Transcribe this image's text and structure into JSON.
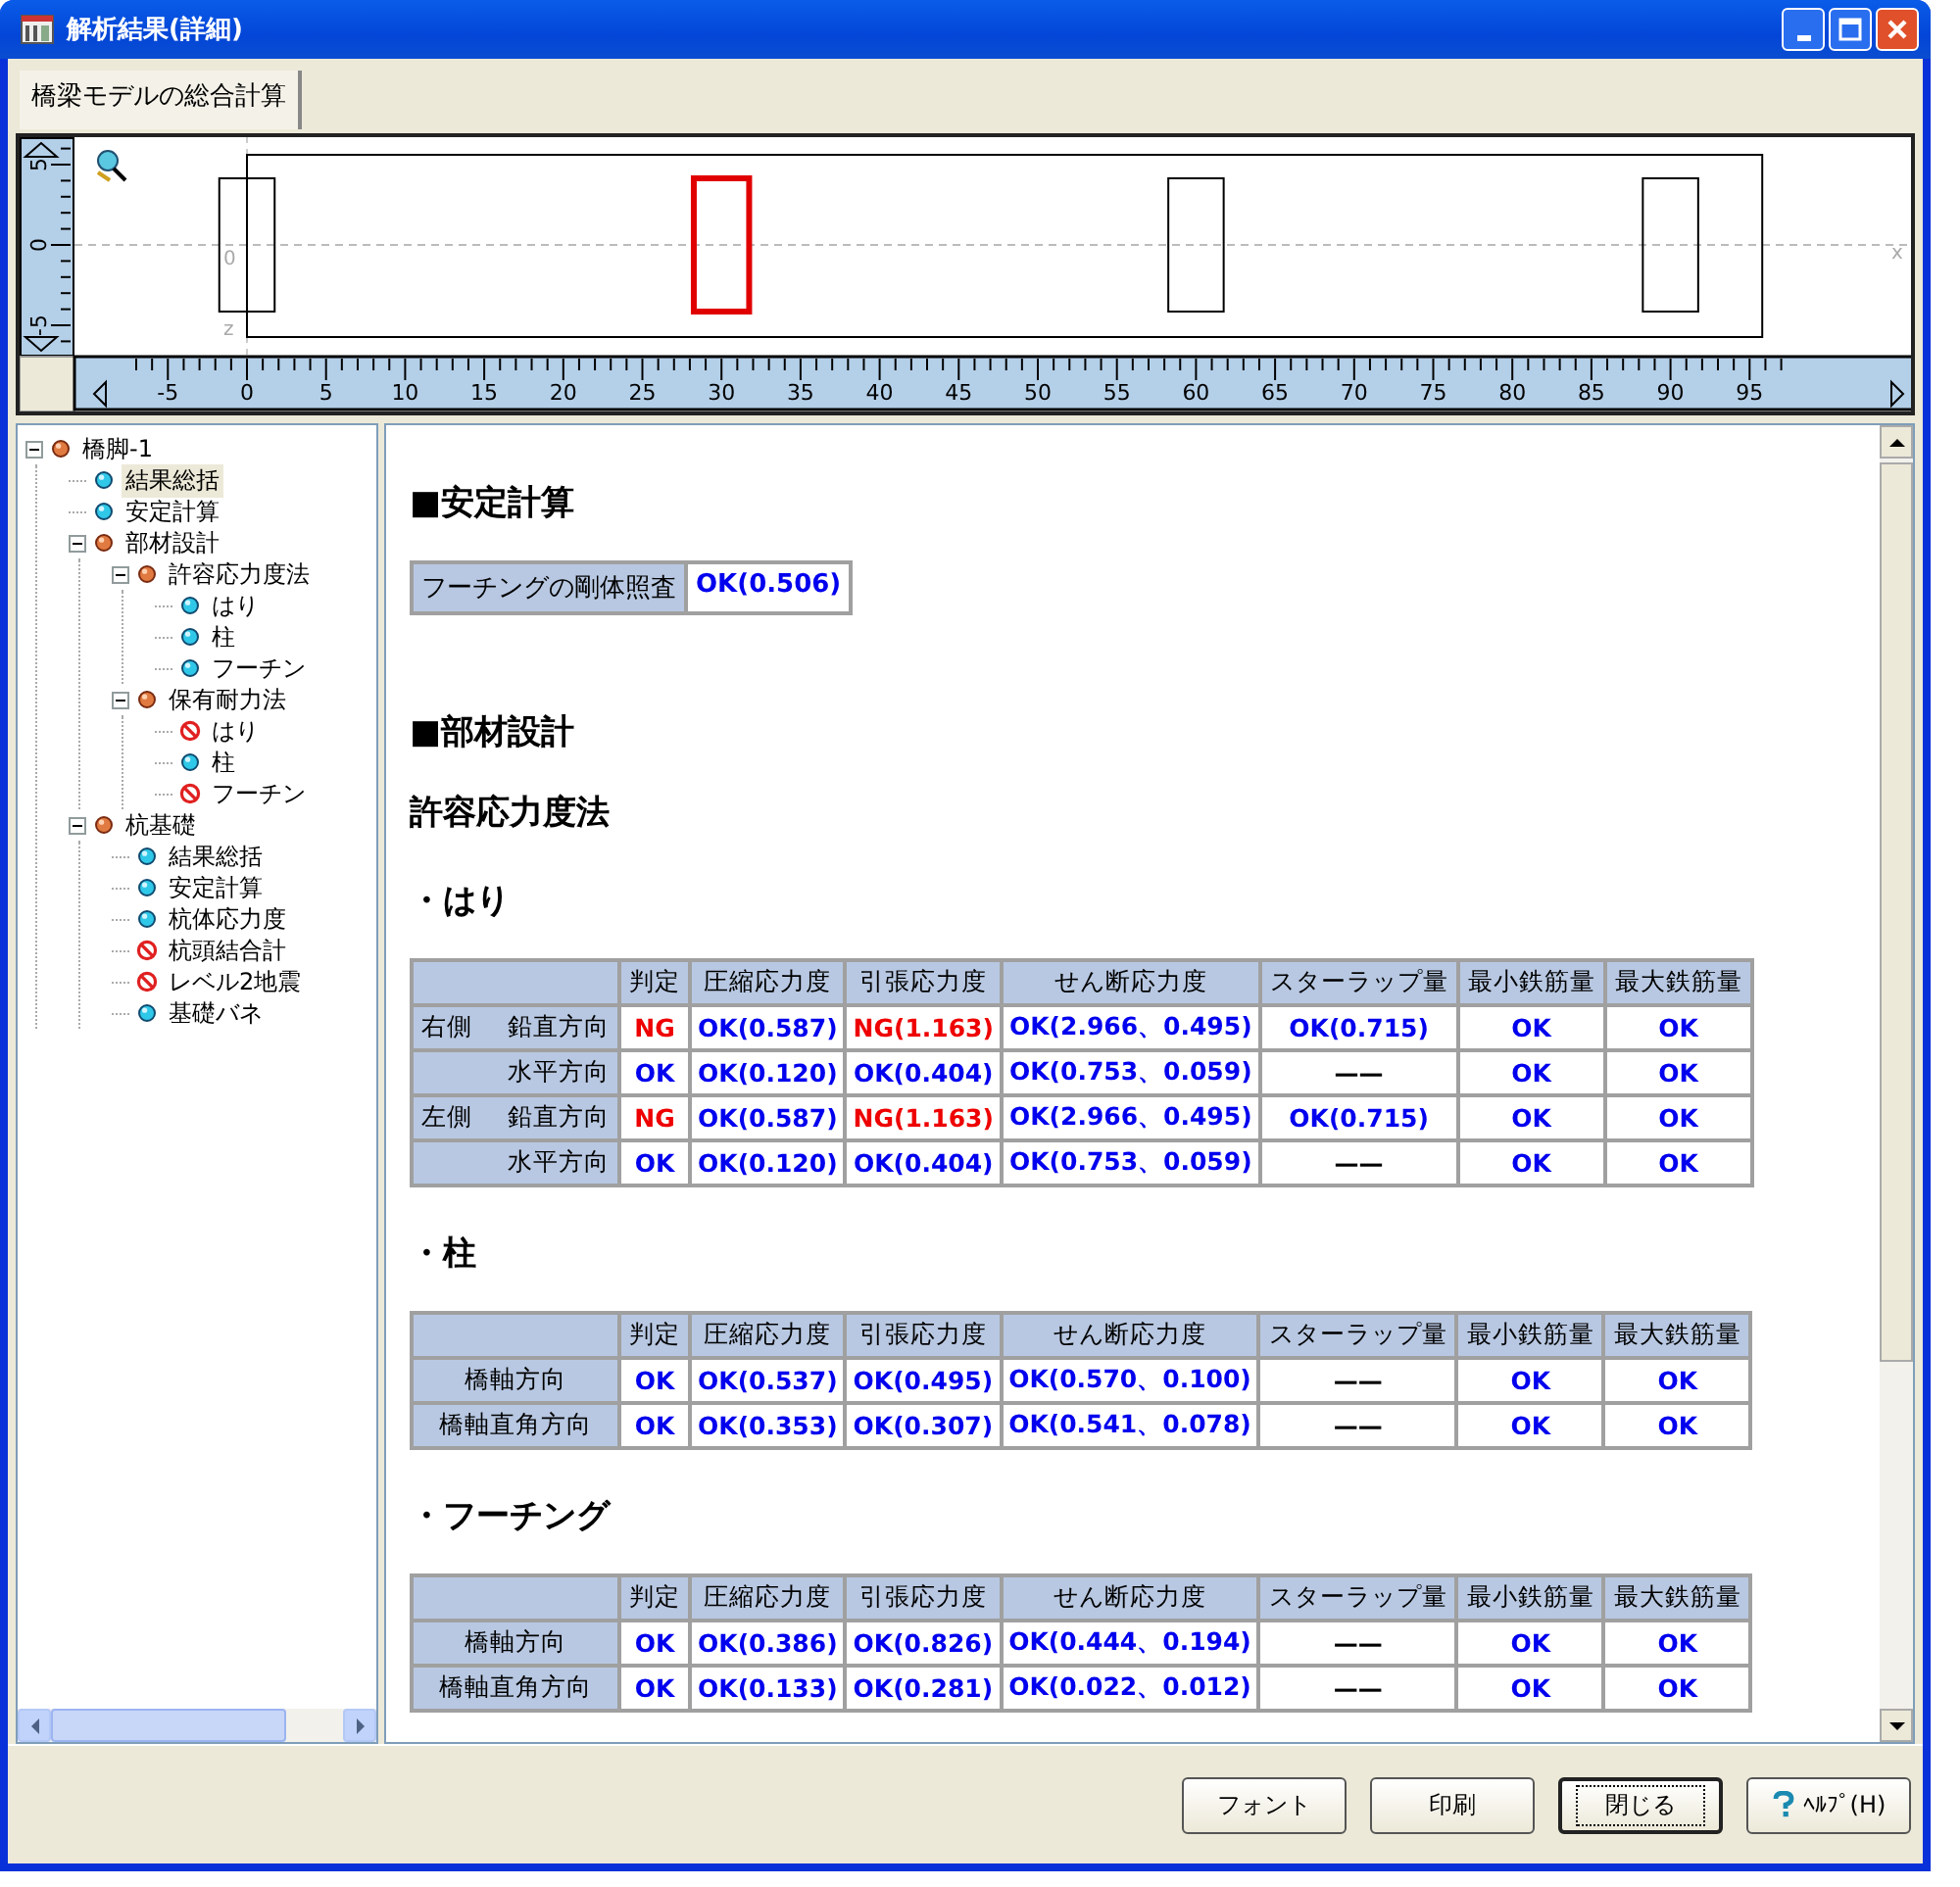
{
  "window": {
    "title": "解析結果(詳細)"
  },
  "tabs": [
    {
      "label": "橋梁モデルの総合計算",
      "selected": true
    }
  ],
  "diagram": {
    "origin_label": "0",
    "z_label": "z",
    "x_label": "x",
    "x_ruler_labels": [
      "-5",
      "0",
      "5",
      "10",
      "15",
      "20",
      "25",
      "30",
      "35",
      "40",
      "45",
      "50",
      "55",
      "60",
      "65",
      "70",
      "75",
      "80",
      "85",
      "90",
      "95"
    ],
    "y_ruler_labels": [
      "5",
      "0",
      "-5"
    ],
    "piers": [
      {
        "selected": false
      },
      {
        "selected": true
      },
      {
        "selected": false
      },
      {
        "selected": false
      }
    ]
  },
  "tree": [
    {
      "label": "橋脚-1",
      "kind": "group",
      "expanded": true,
      "selected": false,
      "children": [
        {
          "label": "結果総括",
          "kind": "ok",
          "selected": true
        },
        {
          "label": "安定計算",
          "kind": "ok",
          "selected": false
        },
        {
          "label": "部材設計",
          "kind": "group",
          "expanded": true,
          "selected": false,
          "children": [
            {
              "label": "許容応力度法",
              "kind": "group",
              "expanded": true,
              "selected": false,
              "children": [
                {
                  "label": "はり",
                  "kind": "ok",
                  "selected": false
                },
                {
                  "label": "柱",
                  "kind": "ok",
                  "selected": false
                },
                {
                  "label": "フーチン",
                  "kind": "ok",
                  "selected": false
                }
              ]
            },
            {
              "label": "保有耐力法",
              "kind": "group",
              "expanded": true,
              "selected": false,
              "children": [
                {
                  "label": "はり",
                  "kind": "ng",
                  "selected": false
                },
                {
                  "label": "柱",
                  "kind": "ok",
                  "selected": false
                },
                {
                  "label": "フーチン",
                  "kind": "ng",
                  "selected": false
                }
              ]
            }
          ]
        },
        {
          "label": "杭基礎",
          "kind": "group",
          "expanded": true,
          "selected": false,
          "children": [
            {
              "label": "結果総括",
              "kind": "ok",
              "selected": false
            },
            {
              "label": "安定計算",
              "kind": "ok",
              "selected": false
            },
            {
              "label": "杭体応力度",
              "kind": "ok",
              "selected": false
            },
            {
              "label": "杭頭結合計",
              "kind": "ng",
              "selected": false
            },
            {
              "label": "レベル2地震",
              "kind": "ng",
              "selected": false
            },
            {
              "label": "基礎バネ",
              "kind": "ok",
              "selected": false
            }
          ]
        }
      ]
    }
  ],
  "content": [
    {
      "kind": "heading",
      "text": "■安定計算"
    },
    {
      "kind": "check",
      "label": "フーチングの剛体照査",
      "value": "OK(0.506)",
      "ng": false
    },
    {
      "kind": "heading",
      "text": "■部材設計"
    },
    {
      "kind": "subheading",
      "text": "許容応力度法"
    },
    {
      "kind": "section",
      "text": "・はり"
    },
    {
      "kind": "table",
      "columns": [
        "判定",
        "圧縮応力度",
        "引張応力度",
        "せん断応力度",
        "スターラップ量",
        "最小鉄筋量",
        "最大鉄筋量"
      ],
      "rows": [
        {
          "group": "右側",
          "label": "鉛直方向",
          "cells": [
            {
              "text": "NG",
              "kind": "ng"
            },
            {
              "text": "OK(0.587)",
              "kind": "ok"
            },
            {
              "text": "NG(1.163)",
              "kind": "ng"
            },
            {
              "text": "OK(2.966、0.495)",
              "kind": "ok"
            },
            {
              "text": "OK(0.715)",
              "kind": "ok"
            },
            {
              "text": "OK",
              "kind": "ok"
            },
            {
              "text": "OK",
              "kind": "ok"
            }
          ]
        },
        {
          "label": "水平方向",
          "cells": [
            {
              "text": "OK",
              "kind": "ok"
            },
            {
              "text": "OK(0.120)",
              "kind": "ok"
            },
            {
              "text": "OK(0.404)",
              "kind": "ok"
            },
            {
              "text": "OK(0.753、0.059)",
              "kind": "ok"
            },
            {
              "text": "——",
              "kind": "dash"
            },
            {
              "text": "OK",
              "kind": "ok"
            },
            {
              "text": "OK",
              "kind": "ok"
            }
          ]
        },
        {
          "group": "左側",
          "label": "鉛直方向",
          "cells": [
            {
              "text": "NG",
              "kind": "ng"
            },
            {
              "text": "OK(0.587)",
              "kind": "ok"
            },
            {
              "text": "NG(1.163)",
              "kind": "ng"
            },
            {
              "text": "OK(2.966、0.495)",
              "kind": "ok"
            },
            {
              "text": "OK(0.715)",
              "kind": "ok"
            },
            {
              "text": "OK",
              "kind": "ok"
            },
            {
              "text": "OK",
              "kind": "ok"
            }
          ]
        },
        {
          "label": "水平方向",
          "cells": [
            {
              "text": "OK",
              "kind": "ok"
            },
            {
              "text": "OK(0.120)",
              "kind": "ok"
            },
            {
              "text": "OK(0.404)",
              "kind": "ok"
            },
            {
              "text": "OK(0.753、0.059)",
              "kind": "ok"
            },
            {
              "text": "——",
              "kind": "dash"
            },
            {
              "text": "OK",
              "kind": "ok"
            },
            {
              "text": "OK",
              "kind": "ok"
            }
          ]
        }
      ]
    },
    {
      "kind": "section",
      "text": "・柱"
    },
    {
      "kind": "table",
      "columns": [
        "判定",
        "圧縮応力度",
        "引張応力度",
        "せん断応力度",
        "スターラップ量",
        "最小鉄筋量",
        "最大鉄筋量"
      ],
      "rows": [
        {
          "label": "橋軸方向",
          "cells": [
            {
              "text": "OK",
              "kind": "ok"
            },
            {
              "text": "OK(0.537)",
              "kind": "ok"
            },
            {
              "text": "OK(0.495)",
              "kind": "ok"
            },
            {
              "text": "OK(0.570、0.100)",
              "kind": "ok"
            },
            {
              "text": "——",
              "kind": "dash"
            },
            {
              "text": "OK",
              "kind": "ok"
            },
            {
              "text": "OK",
              "kind": "ok"
            }
          ]
        },
        {
          "label": "橋軸直角方向",
          "cells": [
            {
              "text": "OK",
              "kind": "ok"
            },
            {
              "text": "OK(0.353)",
              "kind": "ok"
            },
            {
              "text": "OK(0.307)",
              "kind": "ok"
            },
            {
              "text": "OK(0.541、0.078)",
              "kind": "ok"
            },
            {
              "text": "——",
              "kind": "dash"
            },
            {
              "text": "OK",
              "kind": "ok"
            },
            {
              "text": "OK",
              "kind": "ok"
            }
          ]
        }
      ]
    },
    {
      "kind": "section",
      "text": "・フーチング"
    },
    {
      "kind": "table",
      "columns": [
        "判定",
        "圧縮応力度",
        "引張応力度",
        "せん断応力度",
        "スターラップ量",
        "最小鉄筋量",
        "最大鉄筋量"
      ],
      "rows": [
        {
          "label": "橋軸方向",
          "cells": [
            {
              "text": "OK",
              "kind": "ok"
            },
            {
              "text": "OK(0.386)",
              "kind": "ok"
            },
            {
              "text": "OK(0.826)",
              "kind": "ok"
            },
            {
              "text": "OK(0.444、0.194)",
              "kind": "ok"
            },
            {
              "text": "——",
              "kind": "dash"
            },
            {
              "text": "OK",
              "kind": "ok"
            },
            {
              "text": "OK",
              "kind": "ok"
            }
          ]
        },
        {
          "label": "橋軸直角方向",
          "cells": [
            {
              "text": "OK",
              "kind": "ok"
            },
            {
              "text": "OK(0.133)",
              "kind": "ok"
            },
            {
              "text": "OK(0.281)",
              "kind": "ok"
            },
            {
              "text": "OK(0.022、0.012)",
              "kind": "ok"
            },
            {
              "text": "——",
              "kind": "dash"
            },
            {
              "text": "OK",
              "kind": "ok"
            },
            {
              "text": "OK",
              "kind": "ok"
            }
          ]
        }
      ]
    }
  ],
  "buttons": [
    {
      "label": "フォント",
      "focused": false,
      "kind": "plain"
    },
    {
      "label": "印刷",
      "focused": false,
      "kind": "plain"
    },
    {
      "label": "閉じる",
      "focused": true,
      "kind": "plain"
    },
    {
      "label": "ﾍﾙﾌﾟ(H)",
      "focused": false,
      "kind": "help"
    }
  ]
}
